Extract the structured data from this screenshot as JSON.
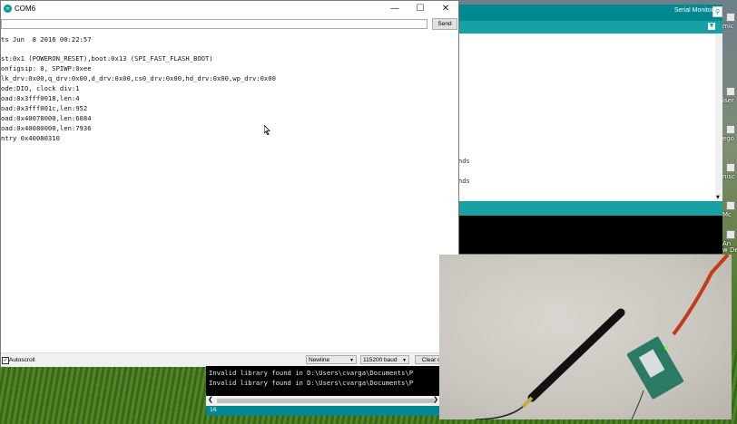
{
  "serial_monitor": {
    "title": "COM6",
    "send_label": "Send",
    "send_input_value": "",
    "output_lines": [
      "ts Jun  8 2016 00:22:57",
      "",
      "st:0x1 (POWERON_RESET),boot:0x13 (SPI_FAST_FLASH_BOOT)",
      "onfigsip: 0, SPIWP:0xee",
      "lk_drv:0x00,q_drv:0x00,d_drv:0x00,cs0_drv:0x00,hd_drv:0x00,wp_drv:0x00",
      "ode:DIO, clock div:1",
      "oad:0x3fff0018,len:4",
      "oad:0x3fff001c,len:952",
      "oad:0x40078000,len:6084",
      "oad:0x40080000,len:7936",
      "ntry 0x40080310"
    ],
    "autoscroll_label": "Autoscroll",
    "autoscroll_checked": true,
    "line_ending": "Newline",
    "baud_rate": "115200 baud",
    "clear_label": "Clear ou"
  },
  "ide": {
    "serial_monitor_label": "Serial Monitor",
    "editor_fragments": [
      "nds",
      "nds"
    ],
    "colors": {
      "header": "#00878f",
      "tabs": "#17a1a5"
    }
  },
  "console": {
    "lines": [
      "Invalid library found in D:\\Users\\cvarga\\Documents\\P",
      "Invalid library found in D:\\Users\\cvarga\\Documents\\P"
    ],
    "status_line": "16"
  },
  "desktop_icons": [
    "mic",
    "iser",
    "ego",
    "nisc",
    "Mc",
    "An",
    "w De"
  ]
}
